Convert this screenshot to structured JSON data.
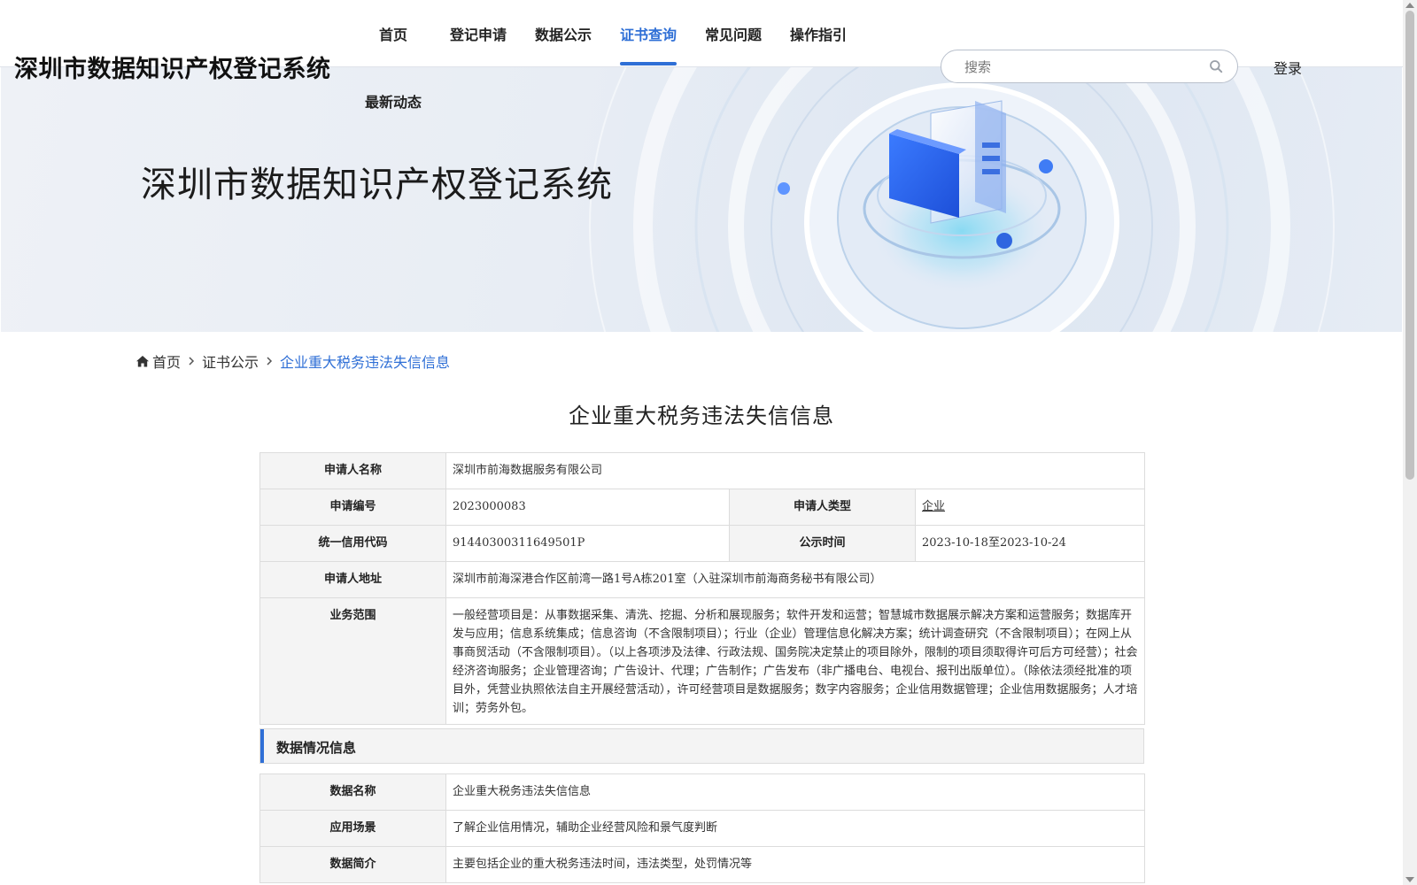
{
  "site": {
    "title": "深圳市数据知识产权登记系统"
  },
  "nav": {
    "items": [
      {
        "label": "首页"
      },
      {
        "label": "登记申请"
      },
      {
        "label": "数据公示"
      },
      {
        "label": "证书查询"
      },
      {
        "label": "常见问题"
      },
      {
        "label": "操作指引"
      }
    ],
    "active": "证书查询",
    "second_row": "最新动态"
  },
  "search": {
    "placeholder": "搜索",
    "value": ""
  },
  "login_label": "登录",
  "banner": {
    "title": "深圳市数据知识产权登记系统"
  },
  "breadcrumb": {
    "home": "首页",
    "parent": "证书公示",
    "current": "企业重大税务违法失信信息"
  },
  "page_title": "企业重大税务违法失信信息",
  "applicant": {
    "name_label": "申请人名称",
    "name": "深圳市前海数据服务有限公司",
    "app_no_label": "申请编号",
    "app_no": "2023000083",
    "type_label": "申请人类型",
    "type": "企业",
    "credit_code_label": "统一信用代码",
    "credit_code": "91440300311649501P",
    "publicity_label": "公示时间",
    "publicity_time": "2023-10-18至2023-10-24",
    "address_label": "申请人地址",
    "address": "深圳市前海深港合作区前湾一路1号A栋201室（入驻深圳市前海商务秘书有限公司）",
    "scope_label": "业务范围",
    "scope": "一般经营项目是：从事数据采集、清洗、挖掘、分析和展现服务；软件开发和运营；智慧城市数据展示解决方案和运营服务；数据库开发与应用；信息系统集成；信息咨询（不含限制项目）；行业（企业）管理信息化解决方案；统计调查研究（不含限制项目）；在网上从事商贸活动（不含限制项目）。（以上各项涉及法律、行政法规、国务院决定禁止的项目除外，限制的项目须取得许可后方可经营）；社会经济咨询服务；企业管理咨询；广告设计、代理；广告制作；广告发布（非广播电台、电视台、报刊出版单位）。（除依法须经批准的项目外，凭营业执照依法自主开展经营活动），许可经营项目是数据服务；数字内容服务；企业信用数据管理；企业信用数据服务；人才培训；劳务外包。"
  },
  "data_section": {
    "title": "数据情况信息",
    "name_label": "数据名称",
    "name": "企业重大税务违法失信信息",
    "scenario_label": "应用场景",
    "scenario": "了解企业信用情况，辅助企业经营风险和景气度判断",
    "intro_label": "数据简介",
    "intro": "主要包括企业的重大税务违法时间，违法类型，处罚情况等"
  },
  "colors": {
    "accent": "#2f6fd6",
    "label_bg": "#f4f4f4",
    "border": "#dcdcdc"
  },
  "icons": {
    "home": "home-icon",
    "search": "search-icon",
    "chevron": "chevron-right-icon"
  }
}
